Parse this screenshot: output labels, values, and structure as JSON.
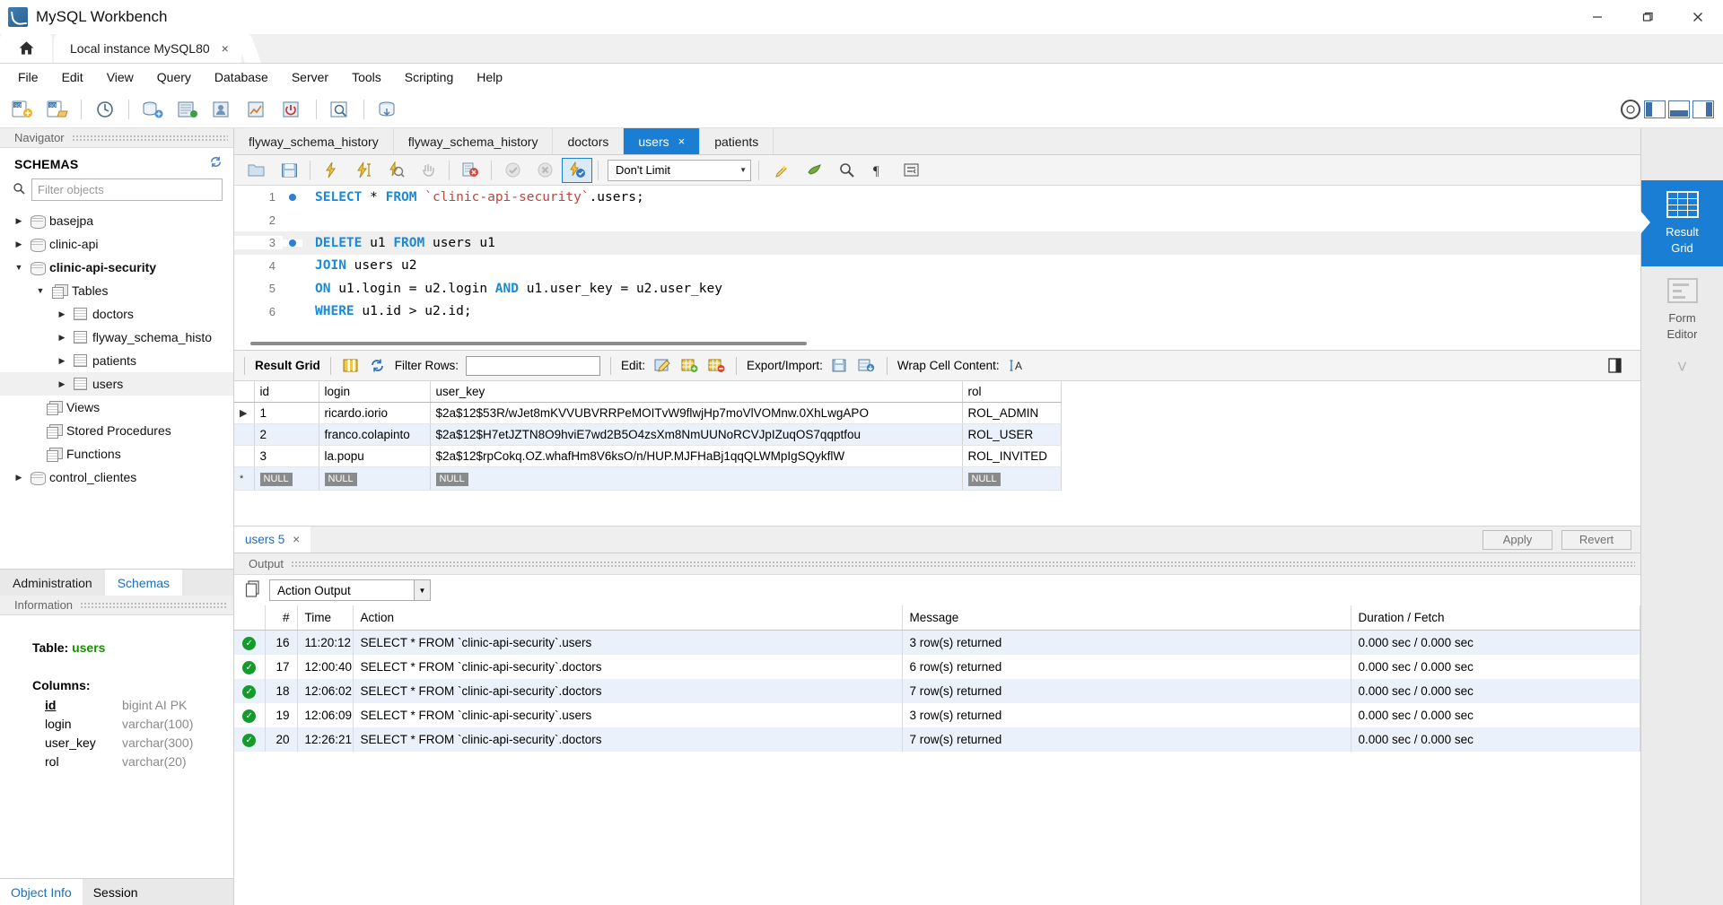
{
  "window": {
    "title": "MySQL Workbench",
    "minimize": "minimize-button",
    "restore": "restore-button",
    "close": "close-button"
  },
  "instance_tabs": {
    "home_icon": "home-icon",
    "tabs": [
      {
        "label": "Local instance MySQL80",
        "close": "×",
        "active": true
      }
    ]
  },
  "menu": {
    "items": [
      "File",
      "Edit",
      "View",
      "Query",
      "Database",
      "Server",
      "Tools",
      "Scripting",
      "Help"
    ]
  },
  "main_toolbar": {
    "buttons": [
      "new-sql-tab-icon",
      "open-sql-script-icon",
      "open-connections-icon",
      "new-connection-icon",
      "server-status-icon",
      "users-privileges-icon",
      "performance-dashboard-icon",
      "startup-shutdown-icon",
      "inspector-icon",
      "data-export-icon"
    ],
    "right": {
      "help_icon": "help-circle-icon",
      "toggles": [
        "toggle-sidebar-icon",
        "toggle-output-icon",
        "toggle-secondary-sidebar-icon"
      ]
    }
  },
  "navigator": {
    "panel_title": "Navigator",
    "section_title": "SCHEMAS",
    "refresh_icon": "refresh-icon",
    "filter": {
      "placeholder": "Filter objects",
      "value": "",
      "icon": "search-icon"
    },
    "tree": [
      {
        "label": "basejpa",
        "type": "schema",
        "depth": 0,
        "expanded": false,
        "bold": false,
        "selected": false
      },
      {
        "label": "clinic-api",
        "type": "schema",
        "depth": 0,
        "expanded": false,
        "bold": false,
        "selected": false
      },
      {
        "label": "clinic-api-security",
        "type": "schema",
        "depth": 0,
        "expanded": true,
        "bold": true,
        "selected": false
      },
      {
        "label": "Tables",
        "type": "group",
        "depth": 1,
        "expanded": true,
        "bold": false,
        "selected": false
      },
      {
        "label": "doctors",
        "type": "table",
        "depth": 2,
        "expanded": false,
        "bold": false,
        "selected": false
      },
      {
        "label": "flyway_schema_histo",
        "type": "table",
        "depth": 2,
        "expanded": false,
        "bold": false,
        "selected": false
      },
      {
        "label": "patients",
        "type": "table",
        "depth": 2,
        "expanded": false,
        "bold": false,
        "selected": false
      },
      {
        "label": "users",
        "type": "table",
        "depth": 2,
        "expanded": false,
        "bold": false,
        "selected": true
      },
      {
        "label": "Views",
        "type": "group",
        "depth": 1,
        "expanded": null,
        "bold": false,
        "selected": false
      },
      {
        "label": "Stored Procedures",
        "type": "group",
        "depth": 1,
        "expanded": null,
        "bold": false,
        "selected": false
      },
      {
        "label": "Functions",
        "type": "group",
        "depth": 1,
        "expanded": null,
        "bold": false,
        "selected": false
      },
      {
        "label": "control_clientes",
        "type": "schema",
        "depth": 0,
        "expanded": false,
        "bold": false,
        "selected": false
      }
    ],
    "bottom_tabs": [
      {
        "label": "Administration",
        "active": false
      },
      {
        "label": "Schemas",
        "active": true
      }
    ]
  },
  "information": {
    "panel_title": "Information",
    "table_label": "Table:",
    "table_name": "users",
    "columns_label": "Columns:",
    "columns": [
      {
        "name": "id",
        "type": "bigint AI PK",
        "pk": true
      },
      {
        "name": "login",
        "type": "varchar(100)",
        "pk": false
      },
      {
        "name": "user_key",
        "type": "varchar(300)",
        "pk": false
      },
      {
        "name": "rol",
        "type": "varchar(20)",
        "pk": false
      }
    ],
    "bottom_tabs": [
      {
        "label": "Object Info",
        "active": true
      },
      {
        "label": "Session",
        "active": false
      }
    ]
  },
  "editor": {
    "tabs": [
      {
        "label": "flyway_schema_history",
        "active": false,
        "closable": false
      },
      {
        "label": "flyway_schema_history",
        "active": false,
        "closable": false
      },
      {
        "label": "doctors",
        "active": false,
        "closable": false
      },
      {
        "label": "users",
        "active": true,
        "closable": true,
        "close": "×"
      },
      {
        "label": "patients",
        "active": false,
        "closable": false
      }
    ],
    "toolbar": {
      "buttons": [
        "open-script-icon",
        "save-script-icon",
        "execute-icon",
        "execute-current-statement-icon",
        "explain-icon",
        "stop-icon",
        "toggle-stop-on-error-icon",
        "commit-icon",
        "rollback-icon",
        "toggle-autocommit-icon"
      ],
      "limit_value": "Don't Limit",
      "right_buttons": [
        "beautify-icon",
        "find-icon",
        "search-icon",
        "show-invisible-chars-icon",
        "wrap-lines-icon"
      ]
    },
    "lines": [
      {
        "num": "1",
        "breakpoint": true,
        "highlight": false,
        "tokens": [
          {
            "t": "SELECT",
            "c": "kw"
          },
          {
            "t": " * ",
            "c": ""
          },
          {
            "t": "FROM",
            "c": "kw"
          },
          {
            "t": " ",
            "c": ""
          },
          {
            "t": "`clinic-api-security`",
            "c": "str"
          },
          {
            "t": ".users;",
            "c": ""
          }
        ]
      },
      {
        "num": "2",
        "breakpoint": false,
        "highlight": false,
        "tokens": []
      },
      {
        "num": "3",
        "breakpoint": true,
        "highlight": true,
        "tokens": [
          {
            "t": "DELETE",
            "c": "kw"
          },
          {
            "t": " u1 ",
            "c": ""
          },
          {
            "t": "FROM",
            "c": "kw"
          },
          {
            "t": " users u1",
            "c": ""
          }
        ]
      },
      {
        "num": "4",
        "breakpoint": false,
        "highlight": false,
        "tokens": [
          {
            "t": "JOIN",
            "c": "kw"
          },
          {
            "t": " users u2",
            "c": ""
          }
        ]
      },
      {
        "num": "5",
        "breakpoint": false,
        "highlight": false,
        "tokens": [
          {
            "t": "ON",
            "c": "kw"
          },
          {
            "t": " u1.login = u2.login ",
            "c": ""
          },
          {
            "t": "AND",
            "c": "kw"
          },
          {
            "t": " u1.user_key = u2.user_key",
            "c": ""
          }
        ]
      },
      {
        "num": "6",
        "breakpoint": false,
        "highlight": false,
        "tokens": [
          {
            "t": "WHERE",
            "c": "kw"
          },
          {
            "t": " u1.id > u2.id;",
            "c": ""
          }
        ]
      }
    ]
  },
  "result_toolbar": {
    "result_grid_label": "Result Grid",
    "grid_icon": "grid-view-icon",
    "refresh_icon": "refresh-grid-icon",
    "filter_rows_label": "Filter Rows:",
    "filter_rows_value": "",
    "edit_label": "Edit:",
    "edit_icons": [
      "edit-cell-icon",
      "insert-row-icon",
      "delete-row-icon"
    ],
    "export_label": "Export/Import:",
    "export_icons": [
      "export-recordset-icon",
      "import-recordset-icon"
    ],
    "wrap_label": "Wrap Cell Content:",
    "wrap_icon": "wrap-cell-icon",
    "panel_toggle_icon": "toggle-panel-icon"
  },
  "result_grid": {
    "columns": [
      "",
      "id",
      "login",
      "user_key",
      "rol"
    ],
    "rows": [
      {
        "marker": "▶",
        "id": "1",
        "login": "ricardo.iorio",
        "user_key": "$2a$12$53R/wJet8mKVVUBVRRPeMOITvW9flwjHp7moVlVOMnw.0XhLwgAPO",
        "rol": "ROL_ADMIN",
        "alt": false
      },
      {
        "marker": "",
        "id": "2",
        "login": "franco.colapinto",
        "user_key": "$2a$12$H7etJZTN8O9hviE7wd2B5O4zsXm8NmUUNoRCVJpIZuqOS7qqptfou",
        "rol": "ROL_USER",
        "alt": true
      },
      {
        "marker": "",
        "id": "3",
        "login": "la.popu",
        "user_key": "$2a$12$rpCokq.OZ.whafHm8V6ksO/n/HUP.MJFHaBj1qqQLWMpIgSQykflW",
        "rol": "ROL_INVITED",
        "alt": false
      },
      {
        "marker": "*",
        "id": "NULL",
        "login": "NULL",
        "user_key": "NULL",
        "rol": "NULL",
        "alt": false,
        "isnull": true
      }
    ]
  },
  "result_tabs": {
    "tabs": [
      {
        "label": "users 5",
        "close": "×",
        "active": true
      }
    ],
    "apply_label": "Apply",
    "revert_label": "Revert"
  },
  "right_rail": {
    "items": [
      {
        "label": "Result\nGrid",
        "line1": "Result",
        "line2": "Grid",
        "icon": "result-grid-icon",
        "active": true
      },
      {
        "label": "Form\nEditor",
        "line1": "Form",
        "line2": "Editor",
        "icon": "form-editor-icon",
        "active": false
      }
    ],
    "more_icon": "chevron-down-icon"
  },
  "output": {
    "panel_title": "Output",
    "copy_icon": "copy-icon",
    "selector_value": "Action Output",
    "columns": [
      "",
      "#",
      "Time",
      "Action",
      "Message",
      "Duration / Fetch"
    ],
    "rows": [
      {
        "status": "success",
        "num": "16",
        "time": "11:20:12",
        "action": "SELECT * FROM `clinic-api-security`.users",
        "message": "3 row(s) returned",
        "duration": "0.000 sec / 0.000 sec",
        "alt": true
      },
      {
        "status": "success",
        "num": "17",
        "time": "12:00:40",
        "action": "SELECT * FROM `clinic-api-security`.doctors",
        "message": "6 row(s) returned",
        "duration": "0.000 sec / 0.000 sec",
        "alt": false
      },
      {
        "status": "success",
        "num": "18",
        "time": "12:06:02",
        "action": "SELECT * FROM `clinic-api-security`.doctors",
        "message": "7 row(s) returned",
        "duration": "0.000 sec / 0.000 sec",
        "alt": true
      },
      {
        "status": "success",
        "num": "19",
        "time": "12:06:09",
        "action": "SELECT * FROM `clinic-api-security`.users",
        "message": "3 row(s) returned",
        "duration": "0.000 sec / 0.000 sec",
        "alt": false
      },
      {
        "status": "success",
        "num": "20",
        "time": "12:26:21",
        "action": "SELECT * FROM `clinic-api-security`.doctors",
        "message": "7 row(s) returned",
        "duration": "0.000 sec / 0.000 sec",
        "alt": true
      }
    ]
  },
  "colors": {
    "accent": "#1a7fd4",
    "keyword": "#1a8ad4",
    "string": "#b5483d",
    "success": "#159a2e",
    "schema_green": "#159100"
  }
}
